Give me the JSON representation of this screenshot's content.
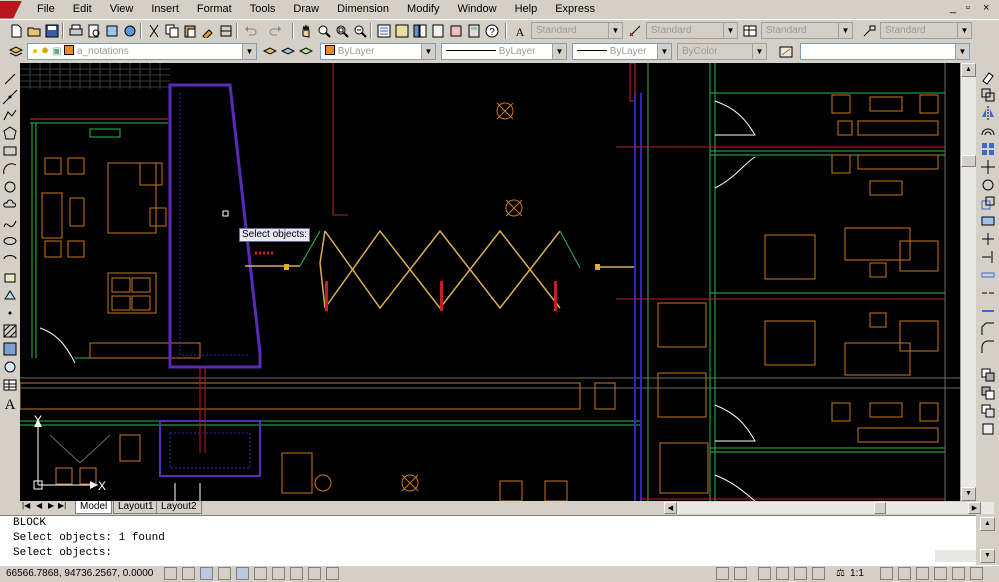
{
  "menu": {
    "items": [
      "File",
      "Edit",
      "View",
      "Insert",
      "Format",
      "Tools",
      "Draw",
      "Dimension",
      "Modify",
      "Window",
      "Help",
      "Express"
    ],
    "window_controls": [
      "_",
      "▫",
      "×"
    ]
  },
  "styles_toolbar": {
    "text_style": "Standard",
    "dim_style": "Standard",
    "table_style": "Standard",
    "multileader_style": "Standard"
  },
  "layers_toolbar": {
    "current_layer": "a_notations",
    "color": "ByLayer",
    "linetype": "ByLayer",
    "lineweight": "ByLayer",
    "plotstyle": "ByColor"
  },
  "canvas": {
    "tooltip": "Select objects:",
    "ucs_y": "Y",
    "ucs_x": "X"
  },
  "tabs": [
    "Model",
    "Layout1",
    "Layout2"
  ],
  "command_line": {
    "line1": "BLOCK",
    "line2": "Select objects: 1 found",
    "line3": "Select objects:"
  },
  "status": {
    "coordinates": "66566.7868, 94736.2567, 0.0000",
    "scale": "1:1"
  },
  "colors": {
    "canvas_bg": "#000000",
    "ui_bg": "#d4d0c8",
    "accent_orange": "#c8781e",
    "accent_green": "#2fb84a"
  }
}
